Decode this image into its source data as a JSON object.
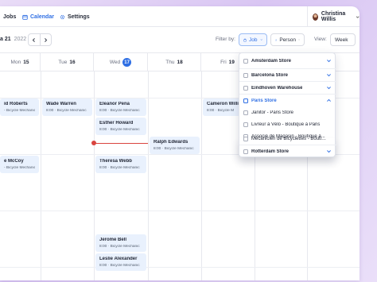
{
  "nav": {
    "items": [
      {
        "label": "Jobs",
        "active": false
      },
      {
        "label": "Calendar",
        "active": true,
        "icon": "calendar-icon"
      },
      {
        "label": "Settings",
        "active": false,
        "icon": "gear-icon"
      }
    ],
    "user": {
      "name": "Christina Willis"
    }
  },
  "toolbar": {
    "date_label": "a 21",
    "year": "2022",
    "filter_label": "Filter by:",
    "job_filter": "Job",
    "person_filter": "Person",
    "view_label": "View:",
    "view_value": "Week"
  },
  "days": [
    {
      "dow": "Mon",
      "num": "15"
    },
    {
      "dow": "Tue",
      "num": "16"
    },
    {
      "dow": "Wed",
      "num": "17",
      "today": true
    },
    {
      "dow": "Thu",
      "num": "18"
    },
    {
      "dow": "Fri",
      "num": "19"
    }
  ],
  "events": [
    {
      "name": "id Roberts",
      "meta": "- Bicycle Mechanic"
    },
    {
      "name": "Wade Warren",
      "meta": "8:00 · Bicycle Mechanic"
    },
    {
      "name": "Eleanor Pena",
      "meta": "8:00 · Bicycle Mechanic"
    },
    {
      "name": "Cameron Willia",
      "meta": "8:00 · Bicycle M"
    },
    {
      "name": "Esther Howard",
      "meta": "8:00 · Bicycle Mechanic"
    },
    {
      "name": "Ralph Edwards",
      "meta": "8:00 · Bicycle Mechanic"
    },
    {
      "name": "e McCoy",
      "meta": "- Bicycle Mechanic"
    },
    {
      "name": "Theresa Webb",
      "meta": "8:00 · Bicycle Mechanic"
    },
    {
      "name": "Jerome Bell",
      "meta": "8:00 · Bicycle Mechanic"
    },
    {
      "name": "Leslie Alexander",
      "meta": "8:00 · Bicycle Mechanic"
    }
  ],
  "dropdown": {
    "rows": [
      {
        "label": "Amsterdam Store",
        "type": "group",
        "expanded": false
      },
      {
        "label": "Barcelona Store",
        "type": "group",
        "expanded": false
      },
      {
        "label": "Eindhoven Warehouse",
        "type": "group",
        "expanded": false
      },
      {
        "label": "Paris Store",
        "type": "group",
        "expanded": true
      },
      {
        "label": "Janitor - Paris Store",
        "type": "child"
      },
      {
        "label": "Livreur à Vélo - Boutique à Paris",
        "type": "child"
      },
      {
        "label": "Associé de Magasin - Boutique à...",
        "type": "child"
      },
      {
        "label": "Mécanicien de Bicyclettes - Boutique à...",
        "type": "child"
      },
      {
        "label": "Rotterdam Store",
        "type": "group",
        "expanded": false
      }
    ]
  },
  "colors": {
    "accent": "#2f6fe4",
    "card_bg": "#e9f1fd",
    "now_line": "#d9443f"
  }
}
